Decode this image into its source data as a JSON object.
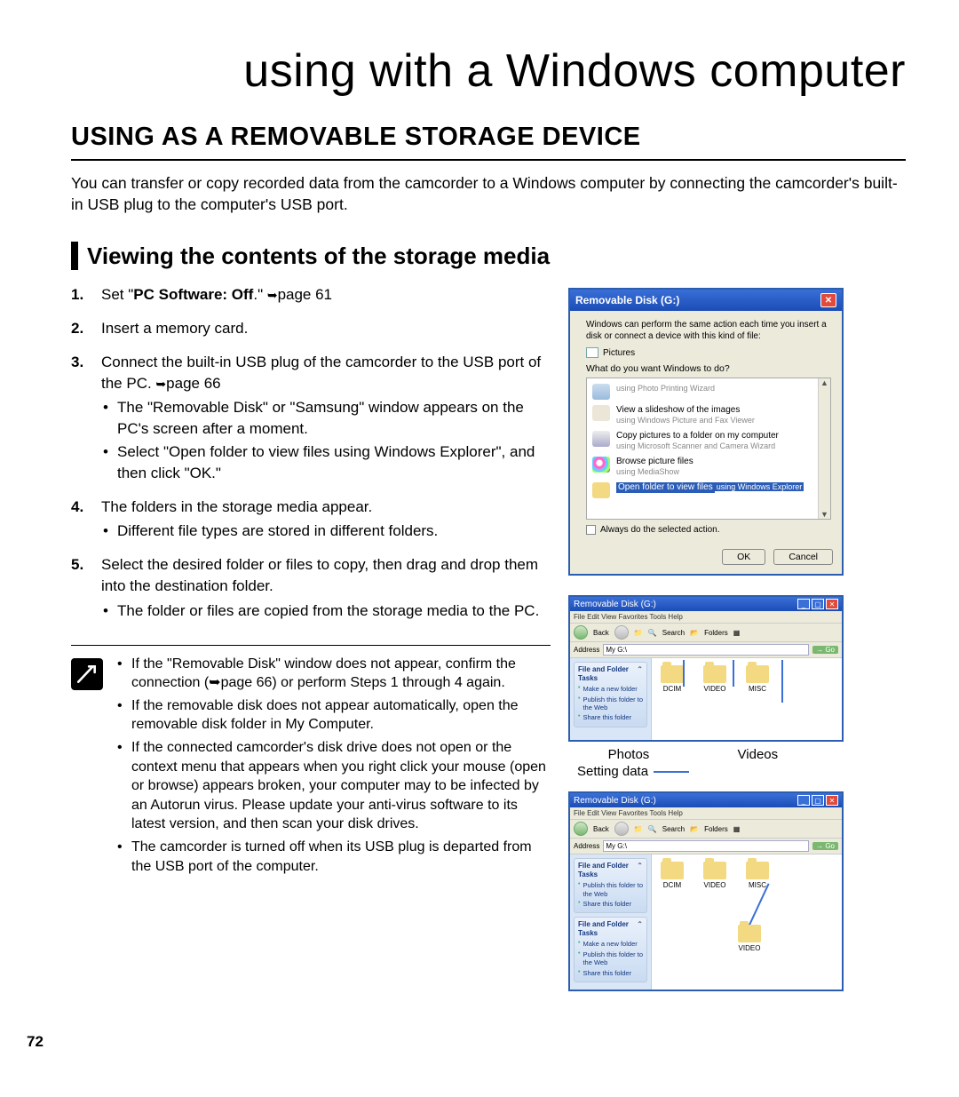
{
  "page_number": "72",
  "title": "using with a Windows computer",
  "section_title": "USING AS A REMOVABLE STORAGE DEVICE",
  "intro": "You can transfer or copy recorded data from the camcorder to a Windows computer by connecting the camcorder's built-in USB plug to the computer's USB port.",
  "subsection_title": "Viewing the contents of the storage media",
  "steps": {
    "s1_a": "Set \"",
    "s1_b": "PC Software: Off",
    "s1_c": ".\" ",
    "s1_d": "page 61",
    "s2": "Insert a memory card.",
    "s3_a": "Connect the built-in USB plug of the camcorder to the USB port of the PC. ",
    "s3_b": "page 66",
    "s3_sub1": "The \"Removable Disk\" or \"Samsung\" window appears on the PC's screen after a moment.",
    "s3_sub2": "Select \"Open folder to view files using Windows Explorer\", and then click \"OK.\"",
    "s4": "The folders in the storage media appear.",
    "s4_sub1": "Different file types are stored in different folders.",
    "s5": "Select the desired folder or files to copy, then drag and drop them into the destination folder.",
    "s5_sub1": "The folder or files are copied from the storage media to the PC."
  },
  "notes": {
    "n1": "If the \"Removable Disk\" window does not appear, confirm the connection (➥page 66) or perform Steps 1 through 4 again.",
    "n2": "If the removable disk does not appear automatically, open the removable disk folder in My Computer.",
    "n3": "If the connected camcorder's disk drive does not open or the context menu that appears when you right click your mouse (open or browse) appears broken, your computer may to be infected by an Autorun virus. Please update your anti-virus software to its latest version, and then scan your disk drives.",
    "n4": "The camcorder is turned off when its USB plug is departed from the USB port of the computer."
  },
  "dialog": {
    "title": "Removable Disk (G:)",
    "msg": "Windows can perform the same action each time you insert a disk or connect a device with this kind of file:",
    "pictures": "Pictures",
    "question": "What do you want Windows to do?",
    "opt1_t1": "using Photo Printing Wizard",
    "opt2_t1": "View a slideshow of the images",
    "opt2_t2": "using Windows Picture and Fax Viewer",
    "opt3_t1": "Copy pictures to a folder on my computer",
    "opt3_t2": "using Microsoft Scanner and Camera Wizard",
    "opt4_t1": "Browse picture files",
    "opt4_t2": "using MediaShow",
    "opt5_t1": "Open folder to view files",
    "opt5_t2": "using Windows Explorer",
    "always": "Always do the selected action.",
    "ok": "OK",
    "cancel": "Cancel"
  },
  "explorer1": {
    "title": "Removable Disk (G:)",
    "menu": "File   Edit   View   Favorites   Tools   Help",
    "back": "Back",
    "search": "Search",
    "folders": "Folders",
    "addr_label": "Address",
    "addr_value": "My G:\\",
    "go": "Go",
    "side_hd": "File and Folder Tasks",
    "side_l1": "Make a new folder",
    "side_l2": "Publish this folder to the Web",
    "side_l3": "Share this folder",
    "f1": "DCIM",
    "f2": "VIDEO",
    "f3": "MISC"
  },
  "labels": {
    "photos": "Photos",
    "videos": "Videos",
    "setting": "Setting data"
  },
  "explorer2": {
    "title": "Removable Disk (G:)",
    "menu": "File   Edit   View   Favorites   Tools   Help",
    "side_hd1": "File and Folder Tasks",
    "side_l1a": "Publish this folder to the Web",
    "side_l1b": "Share this folder",
    "side_hd2": "File and Folder Tasks",
    "side_l2a": "Make a new folder",
    "side_l2b": "Publish this folder to the Web",
    "side_l2c": "Share this folder",
    "f1": "DCIM",
    "f2": "VIDEO",
    "f3": "MISC",
    "f4": "VIDEO"
  }
}
